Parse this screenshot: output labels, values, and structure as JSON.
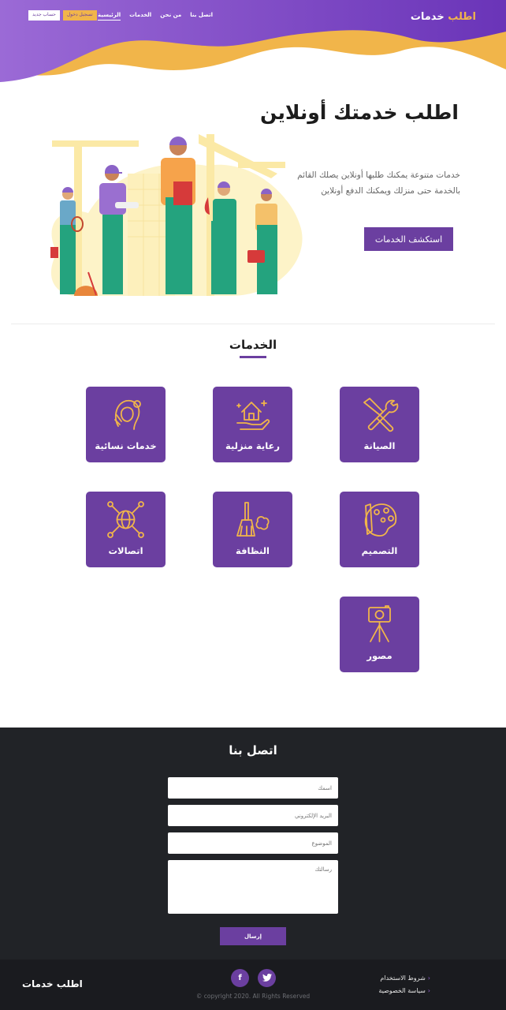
{
  "header": {
    "brand": {
      "primary": "اطلب",
      "secondary": "خدمات"
    },
    "nav": [
      {
        "label": "الرئيسية",
        "active": true
      },
      {
        "label": "الخدمات",
        "active": false
      },
      {
        "label": "من نحن",
        "active": false
      },
      {
        "label": "اتصل بنا",
        "active": false
      }
    ],
    "login_label": "تسجيل دخول",
    "register_label": "حساب جديد"
  },
  "hero": {
    "title": "اطلب خدمتك أونلاين",
    "description": "خدمات متنوعة يمكنك طلبها أونلاين يصلك القائم بالخدمة حتى منزلك ويمكنك الدفع أونلاين",
    "button_label": "استكشف الخدمات"
  },
  "services": {
    "title": "الخدمات",
    "items": [
      {
        "label": "الصيانة",
        "icon": "tools-icon"
      },
      {
        "label": "رعاية منزلية",
        "icon": "home-care-icon"
      },
      {
        "label": "خدمات نسائية",
        "icon": "woman-icon"
      },
      {
        "label": "التصميم",
        "icon": "palette-icon"
      },
      {
        "label": "النظافة",
        "icon": "broom-icon"
      },
      {
        "label": "اتصالات",
        "icon": "globe-network-icon"
      },
      {
        "label": "مصور",
        "icon": "camera-tripod-icon"
      }
    ]
  },
  "contact": {
    "title": "اتصل بنا",
    "name_placeholder": "اسمك",
    "email_placeholder": "البريد الإلكتروني",
    "subject_placeholder": "الموضوع",
    "message_placeholder": "رسالتك",
    "send_label": "إرسال"
  },
  "footer": {
    "brand": "اطلب خدمات",
    "social": [
      {
        "icon": "facebook-icon",
        "glyph": "f"
      },
      {
        "icon": "twitter-icon",
        "glyph": "🐦"
      }
    ],
    "copyright": "© copyright 2020. All Rights Reserved",
    "links": [
      "شروط الاستخدام",
      "سياسة الخصوصية"
    ]
  },
  "colors": {
    "primary": "#6b3fa0",
    "accent": "#f1b54a",
    "dark": "#212327"
  }
}
